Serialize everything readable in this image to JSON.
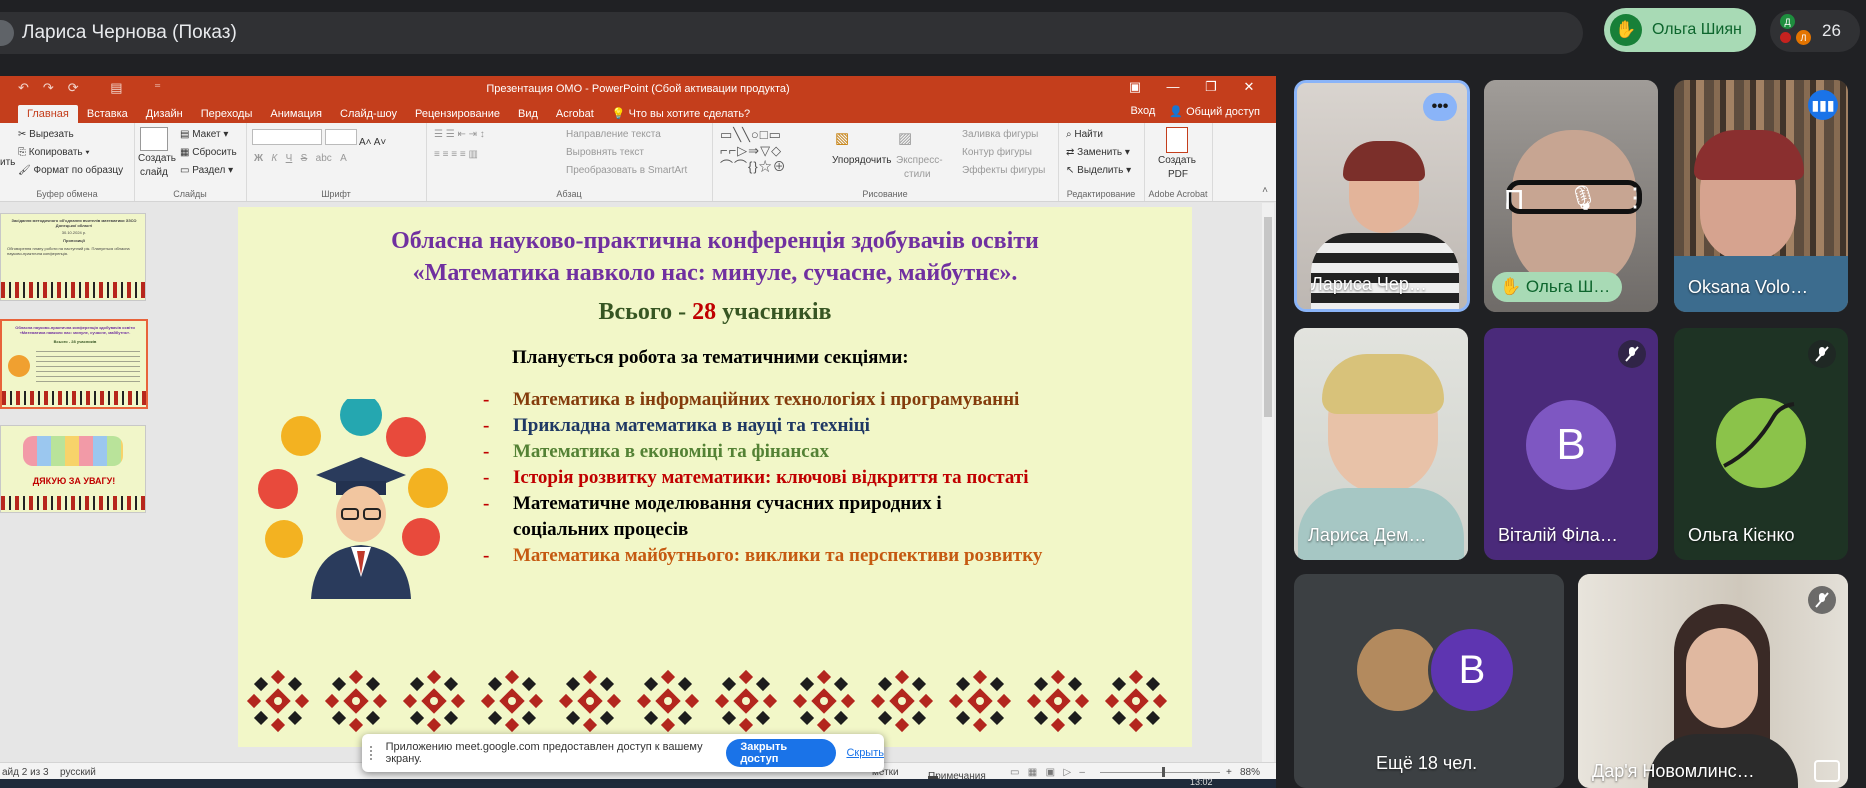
{
  "meet": {
    "presenter_banner": "Лариса Чернова (Показ)",
    "raised_hand_name": "Ольга Шиян",
    "participant_count": "26",
    "mini_avatars": [
      "Д",
      "Л"
    ],
    "share_toast": {
      "message": "Приложению meet.google.com предоставлен доступ к вашему экрану.",
      "stop_button": "Закрыть доступ",
      "hide_link": "Скрыть"
    },
    "tiles": [
      {
        "name": "Лариса Чер…"
      },
      {
        "name": "Ольга Ш…",
        "overlay_letter": "П"
      },
      {
        "name": "Oksana Volo…"
      },
      {
        "name": "Лариса Дем…"
      },
      {
        "name": "Віталій Філа…",
        "avatar": "В"
      },
      {
        "name": "Ольга Кієнко"
      },
      {
        "name": "Ещё 18 чел.",
        "avatar": "В"
      },
      {
        "name": "Дар'я Новомлинс…"
      }
    ],
    "colors": {
      "bg": "#202124",
      "tile": "#3c4043",
      "hand_green": "#a8dab5",
      "purple": "#5e35b1",
      "accent_blue": "#1a73e8"
    }
  },
  "powerpoint": {
    "window_title": "Презентация ОМО - PowerPoint (Сбой активации продукта)",
    "tabs": [
      "Главная",
      "Вставка",
      "Дизайн",
      "Переходы",
      "Анимация",
      "Слайд-шоу",
      "Рецензирование",
      "Вид",
      "Acrobat"
    ],
    "tell_me": "Что вы хотите сделать?",
    "signin": "Вход",
    "share": "Общий доступ",
    "ribbon": {
      "clipboard": {
        "cut": "Вырезать",
        "copy": "Копировать",
        "format_painter": "Формат по образцу",
        "label": "Буфер обмена",
        "paste": "ить"
      },
      "slides": {
        "new_slide": "Создать",
        "new_slide2": "слайд",
        "layout": "Макет",
        "reset": "Сбросить",
        "section": "Раздел",
        "label": "Слайды"
      },
      "font": {
        "label": "Шрифт",
        "bold": "Ж",
        "italic": "К",
        "underline": "Ч",
        "strike": "S",
        "spacing": "abc",
        "font_color": "А"
      },
      "paragraph": {
        "text_direction": "Направление текста",
        "align_text": "Выровнять текст",
        "smartart": "Преобразовать в SmartArt",
        "label": "Абзац"
      },
      "drawing": {
        "arrange": "Упорядочить",
        "quick_styles": "Экспресс-",
        "quick_styles2": "стили",
        "fill": "Заливка фигуры",
        "outline": "Контур фигуры",
        "effects": "Эффекты фигуры",
        "label": "Рисование"
      },
      "editing": {
        "find": "Найти",
        "replace": "Заменить",
        "select": "Выделить",
        "label": "Редактирование"
      },
      "acrobat": {
        "create_pdf": "Создать",
        "create_pdf2": "PDF",
        "label": "Adobe Acrobat"
      }
    },
    "thumbnail_1": {
      "title": "Засідання методичного об'єднання вчителів математики ЗЗСО Донецької області",
      "date": "30.10.2024 р.",
      "heading": "Пропозиції",
      "text": "Обговорення плану роботи на наступний рік. Планується обласна науково-практична конференція."
    },
    "thumbnail_2": {
      "title": "Обласна науково-практична конференція здобувачів освіти «Математика навколо нас: минуле, сучасне, майбутнє».",
      "subtitle": "Всього - 28 учасників"
    },
    "thumbnail_3": {
      "thanks": "ДЯКУЮ ЗА УВАГУ!"
    },
    "slide": {
      "title_line1": "Обласна науково-практична конференція здобувачів  освіти",
      "title_line2": "«Математика навколо нас: минуле, сучасне, майбутнє».",
      "total_prefix": "Всього - ",
      "total_number": "28",
      "total_suffix": " учасників",
      "subheading": "Планується робота за тематичними секціями:",
      "sections": [
        {
          "text": "Математика в інформаційних технологіях і програмуванні",
          "color": "#843c0c"
        },
        {
          "text": "Прикладна математика в науці та техніці",
          "color": "#1f3864"
        },
        {
          "text": "Математика в економіці та фінансах",
          "color": "#548235"
        },
        {
          "text": "Історія розвитку математики: ключові відкриття та постаті",
          "color": "#c00000"
        },
        {
          "text": "Математичне моделювання сучасних природних і",
          "color": "#000000"
        },
        {
          "text": "соціальних процесів",
          "color": "#000000",
          "continuation": true
        },
        {
          "text": "Математика майбутнього: виклики та перспективи розвитку",
          "color": "#c55a11"
        }
      ]
    },
    "status": {
      "slide_info": "айд 2 из 3",
      "language": "русский",
      "notes_trail": "метки",
      "comments": "Примечания",
      "zoom": "88%"
    },
    "taskbar_time": "13:02",
    "colors": {
      "brand": "#c43e1c",
      "slide_bg": "#f2f7c8"
    }
  }
}
